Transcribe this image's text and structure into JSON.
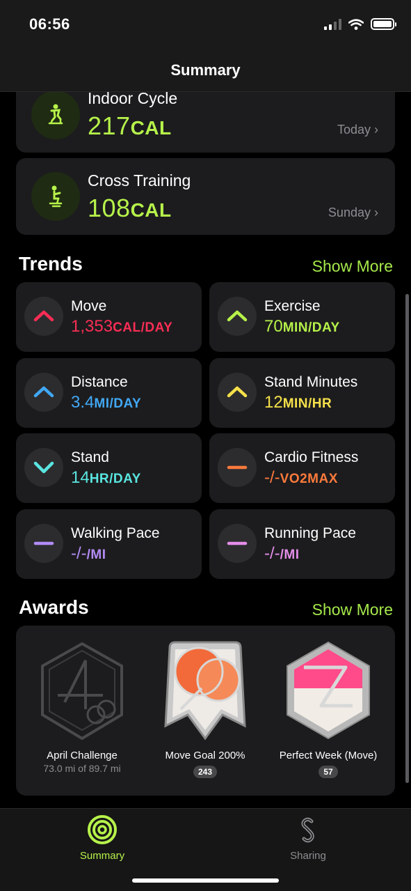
{
  "status_bar": {
    "time": "06:56"
  },
  "nav": {
    "title": "Summary"
  },
  "workouts": [
    {
      "name": "Indoor Cycle",
      "value": "217",
      "unit": "CAL",
      "date": "Today",
      "icon": "indoor-cycle-icon"
    },
    {
      "name": "Cross Training",
      "value": "108",
      "unit": "CAL",
      "date": "Sunday",
      "icon": "cross-training-icon"
    }
  ],
  "trends": {
    "title": "Trends",
    "show_more": "Show More",
    "items": [
      {
        "name": "Move",
        "value": "1,353",
        "unit": "CAL/DAY",
        "direction": "up",
        "color": "#fa2d55"
      },
      {
        "name": "Exercise",
        "value": "70",
        "unit": "MIN/DAY",
        "direction": "up",
        "color": "#b6f24a"
      },
      {
        "name": "Distance",
        "value": "3.4",
        "unit": "MI/DAY",
        "direction": "up",
        "color": "#41a8f5"
      },
      {
        "name": "Stand Minutes",
        "value": "12",
        "unit": "MIN/HR",
        "direction": "up",
        "color": "#f5e04a"
      },
      {
        "name": "Stand",
        "value": "14",
        "unit": "HR/DAY",
        "direction": "down",
        "color": "#5ae5e0"
      },
      {
        "name": "Cardio Fitness",
        "value": "-/-",
        "unit": "VO2MAX",
        "direction": "flat",
        "color": "#fb7a3c"
      },
      {
        "name": "Walking Pace",
        "value": "-/-",
        "unit": "/MI",
        "direction": "flat",
        "color": "#b38cf7"
      },
      {
        "name": "Running Pace",
        "value": "-/-",
        "unit": "/MI",
        "direction": "flat",
        "color": "#e38ee8"
      }
    ]
  },
  "awards": {
    "title": "Awards",
    "show_more": "Show More",
    "items": [
      {
        "name": "April Challenge",
        "subtitle": "73.0 mi of 89.7 mi",
        "count": "",
        "badge": "april-challenge-badge"
      },
      {
        "name": "Move Goal 200%",
        "subtitle": "",
        "count": "243",
        "badge": "move-goal-200-badge"
      },
      {
        "name": "Perfect Week (Move)",
        "subtitle": "",
        "count": "57",
        "badge": "perfect-week-move-badge"
      }
    ]
  },
  "tabbar": {
    "tabs": [
      {
        "label": "Summary",
        "active": true,
        "icon": "summary-rings-icon"
      },
      {
        "label": "Sharing",
        "active": false,
        "icon": "sharing-icon"
      }
    ]
  },
  "colors": {
    "accent": "#b6f24a",
    "card": "#1c1c1e",
    "secondary_text": "#8e8e93"
  }
}
